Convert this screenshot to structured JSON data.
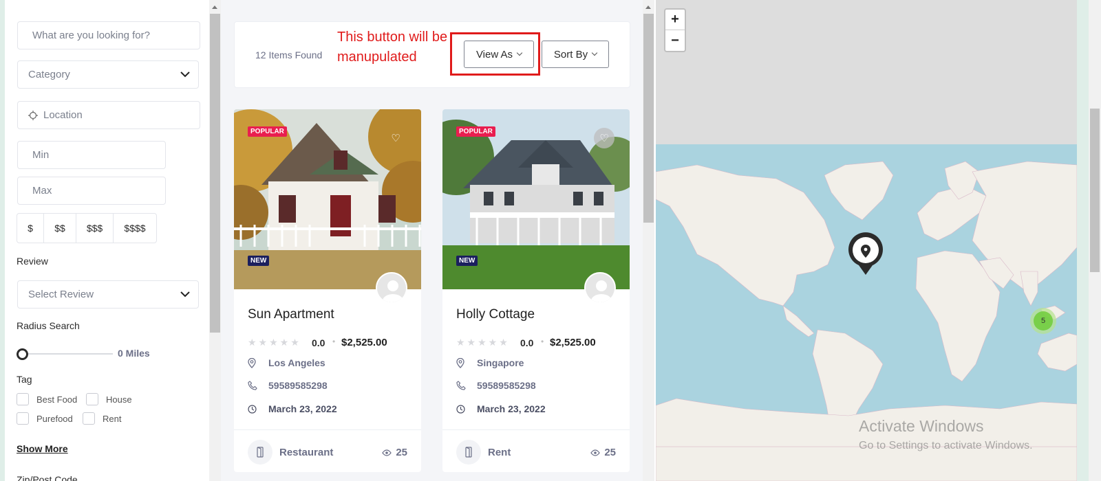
{
  "filters": {
    "search_placeholder": "What are you looking for?",
    "category_placeholder": "Category",
    "location_placeholder": "Location",
    "min_placeholder": "Min",
    "max_placeholder": "Max",
    "price_levels": [
      "$",
      "$$",
      "$$$",
      "$$$$"
    ],
    "review_label": "Review",
    "review_placeholder": "Select Review",
    "radius_label": "Radius Search",
    "radius_value": "0 Miles",
    "radius_level": 0,
    "tag_label": "Tag",
    "tags": [
      "Best Food",
      "House",
      "Purefood",
      "Rent"
    ],
    "show_more": "Show More",
    "zip_label": "Zip/Post Code"
  },
  "results": {
    "count_text": "12 Items Found",
    "annotation": "This button will be manupulated",
    "view_as_label": "View As",
    "sort_by_label": "Sort By"
  },
  "listings": [
    {
      "badge_top": "POPULAR",
      "badge_bottom": "NEW",
      "title": "Sun Apartment",
      "rating": "0.0",
      "price": "$2,525.00",
      "location": "Los Angeles",
      "phone": "59589585298",
      "date": "March 23, 2022",
      "category": "Restaurant",
      "views": "25"
    },
    {
      "badge_top": "POPULAR",
      "badge_bottom": "NEW",
      "title": "Holly Cottage",
      "rating": "0.0",
      "price": "$2,525.00",
      "location": "Singapore",
      "phone": "59589585298",
      "date": "March 23, 2022",
      "category": "Rent",
      "views": "25"
    }
  ],
  "map": {
    "zoom_in": "+",
    "zoom_out": "−",
    "cluster_count": "5",
    "watermark_title": "Activate Windows",
    "watermark_sub": "Go to Settings to activate Windows."
  },
  "icons": {
    "chevron": "chevron-down-icon",
    "crosshair": "crosshair-icon",
    "map_pin": "map-pin-icon",
    "phone": "phone-icon",
    "clock": "clock-icon",
    "eye": "eye-icon",
    "heart": "heart-icon",
    "star": "star-icon"
  },
  "colors": {
    "annotation_red": "#e01b1b",
    "popular_badge": "#e91e4f",
    "new_badge": "#1b1f5e",
    "muted_text": "#6b6f87",
    "map_water": "#aad3df",
    "map_land": "#f2efe9",
    "cluster_green": "#6ecc39"
  }
}
